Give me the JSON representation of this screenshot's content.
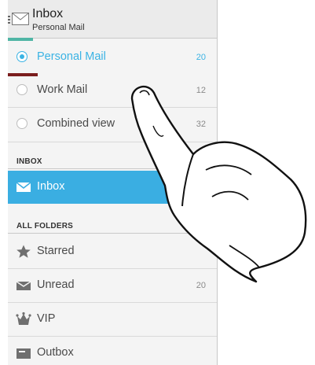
{
  "header": {
    "title": "Inbox",
    "subtitle": "Personal Mail"
  },
  "accounts": [
    {
      "label": "Personal Mail",
      "count": "20",
      "selected": true
    },
    {
      "label": "Work Mail",
      "count": "12",
      "selected": false
    },
    {
      "label": "Combined view",
      "count": "32",
      "selected": false
    }
  ],
  "sections": {
    "inbox": "INBOX",
    "all_folders": "ALL FOLDERS"
  },
  "inbox_item": {
    "label": "Inbox"
  },
  "folders": [
    {
      "label": "Starred",
      "count": "",
      "icon": "star-icon"
    },
    {
      "label": "Unread",
      "count": "20",
      "icon": "unread-mail-icon"
    },
    {
      "label": "VIP",
      "count": "",
      "icon": "crown-icon"
    },
    {
      "label": "Outbox",
      "count": "",
      "icon": "outbox-icon"
    }
  ],
  "colors": {
    "accent": "#3aaee2",
    "personal_bar": "#4fb5a5",
    "work_bar": "#7a1d1d",
    "background": "#f4f4f4"
  }
}
